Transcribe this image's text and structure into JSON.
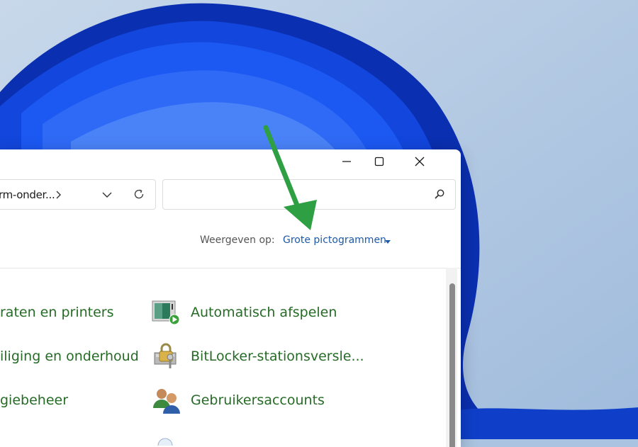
{
  "window": {
    "address_path": "rm-onder...",
    "search_placeholder": "",
    "view_label": "Weergeven op:",
    "view_value": "Grote pictogrammen"
  },
  "items": {
    "left_1": "raten en printers",
    "left_2": "iliging en onderhoud",
    "left_3": "giebeheer",
    "right_1": "Automatisch afspelen",
    "right_2": "BitLocker-stationsversle...",
    "right_3": "Gebruikersaccounts"
  },
  "icons": {
    "minimize": "minimize-icon",
    "maximize": "maximize-icon",
    "close": "close-icon",
    "search": "search-icon",
    "refresh": "refresh-icon",
    "autoplay": "autoplay-icon",
    "bitlocker": "bitlocker-icon",
    "users": "user-accounts-icon",
    "annotation": "green-arrow"
  },
  "colors": {
    "item_text": "#266b26",
    "link_blue": "#1d5aa8",
    "annotation_arrow": "#2ea043"
  }
}
